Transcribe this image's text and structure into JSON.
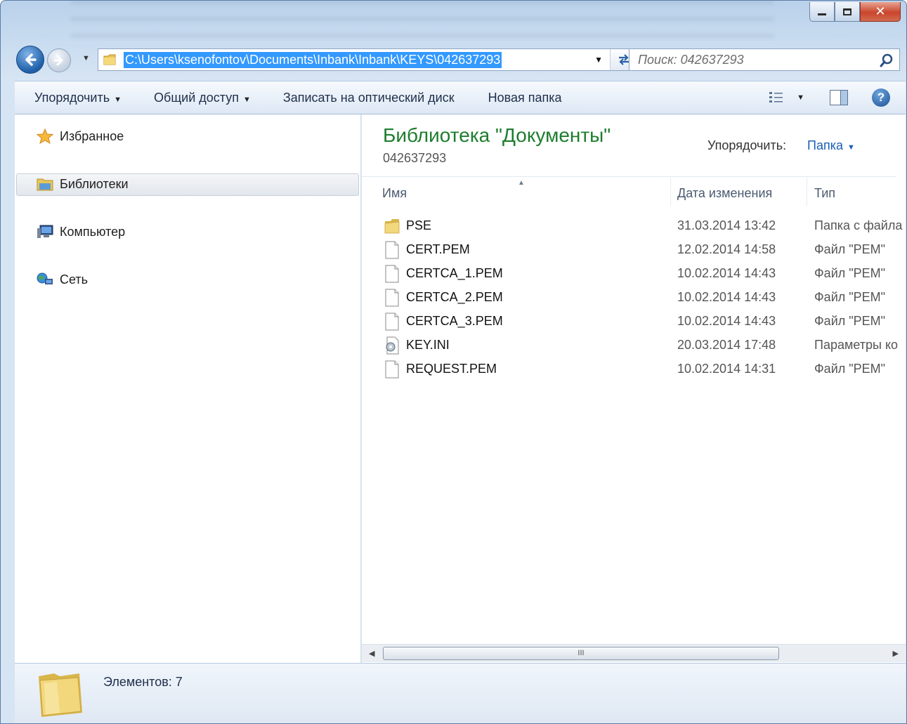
{
  "window": {
    "controls": {
      "minimize": "minimize-icon",
      "maximize": "maximize-icon",
      "close": "close-icon"
    }
  },
  "nav": {
    "address_path": "C:\\Users\\ksenofontov\\Documents\\Inbank\\Inbank\\KEYS\\042637293",
    "search_placeholder": "Поиск: 042637293"
  },
  "toolbar": {
    "organize": "Упорядочить",
    "share": "Общий доступ",
    "burn": "Записать на оптический диск",
    "new_folder": "Новая папка"
  },
  "sidebar": {
    "items": [
      {
        "label": "Избранное",
        "icon": "star-icon"
      },
      {
        "label": "Библиотеки",
        "icon": "library-icon",
        "selected": true
      },
      {
        "label": "Компьютер",
        "icon": "computer-icon"
      },
      {
        "label": "Сеть",
        "icon": "network-icon"
      }
    ]
  },
  "content": {
    "library_title": "Библиотека \"Документы\"",
    "library_subtitle": "042637293",
    "arrange_label": "Упорядочить:",
    "arrange_value": "Папка",
    "columns": {
      "name": "Имя",
      "date": "Дата изменения",
      "type": "Тип"
    },
    "files": [
      {
        "name": "PSE",
        "date": "31.03.2014 13:42",
        "type": "Папка с файла",
        "icon": "folder-icon"
      },
      {
        "name": "CERT.PEM",
        "date": "12.02.2014 14:58",
        "type": "Файл \"PEM\"",
        "icon": "file-icon"
      },
      {
        "name": "CERTCA_1.PEM",
        "date": "10.02.2014 14:43",
        "type": "Файл \"PEM\"",
        "icon": "file-icon"
      },
      {
        "name": "CERTCA_2.PEM",
        "date": "10.02.2014 14:43",
        "type": "Файл \"PEM\"",
        "icon": "file-icon"
      },
      {
        "name": "CERTCA_3.PEM",
        "date": "10.02.2014 14:43",
        "type": "Файл \"PEM\"",
        "icon": "file-icon"
      },
      {
        "name": "KEY.INI",
        "date": "20.03.2014 17:48",
        "type": "Параметры ко",
        "icon": "settings-file-icon"
      },
      {
        "name": "REQUEST.PEM",
        "date": "10.02.2014 14:31",
        "type": "Файл \"PEM\"",
        "icon": "file-icon"
      }
    ]
  },
  "scrollbar": {
    "thumb_grip": "III"
  },
  "status": {
    "text": "Элементов: 7"
  },
  "colors": {
    "accent": "#3399ff",
    "title_green": "#1e7d2e",
    "link_blue": "#1a5fb4"
  }
}
